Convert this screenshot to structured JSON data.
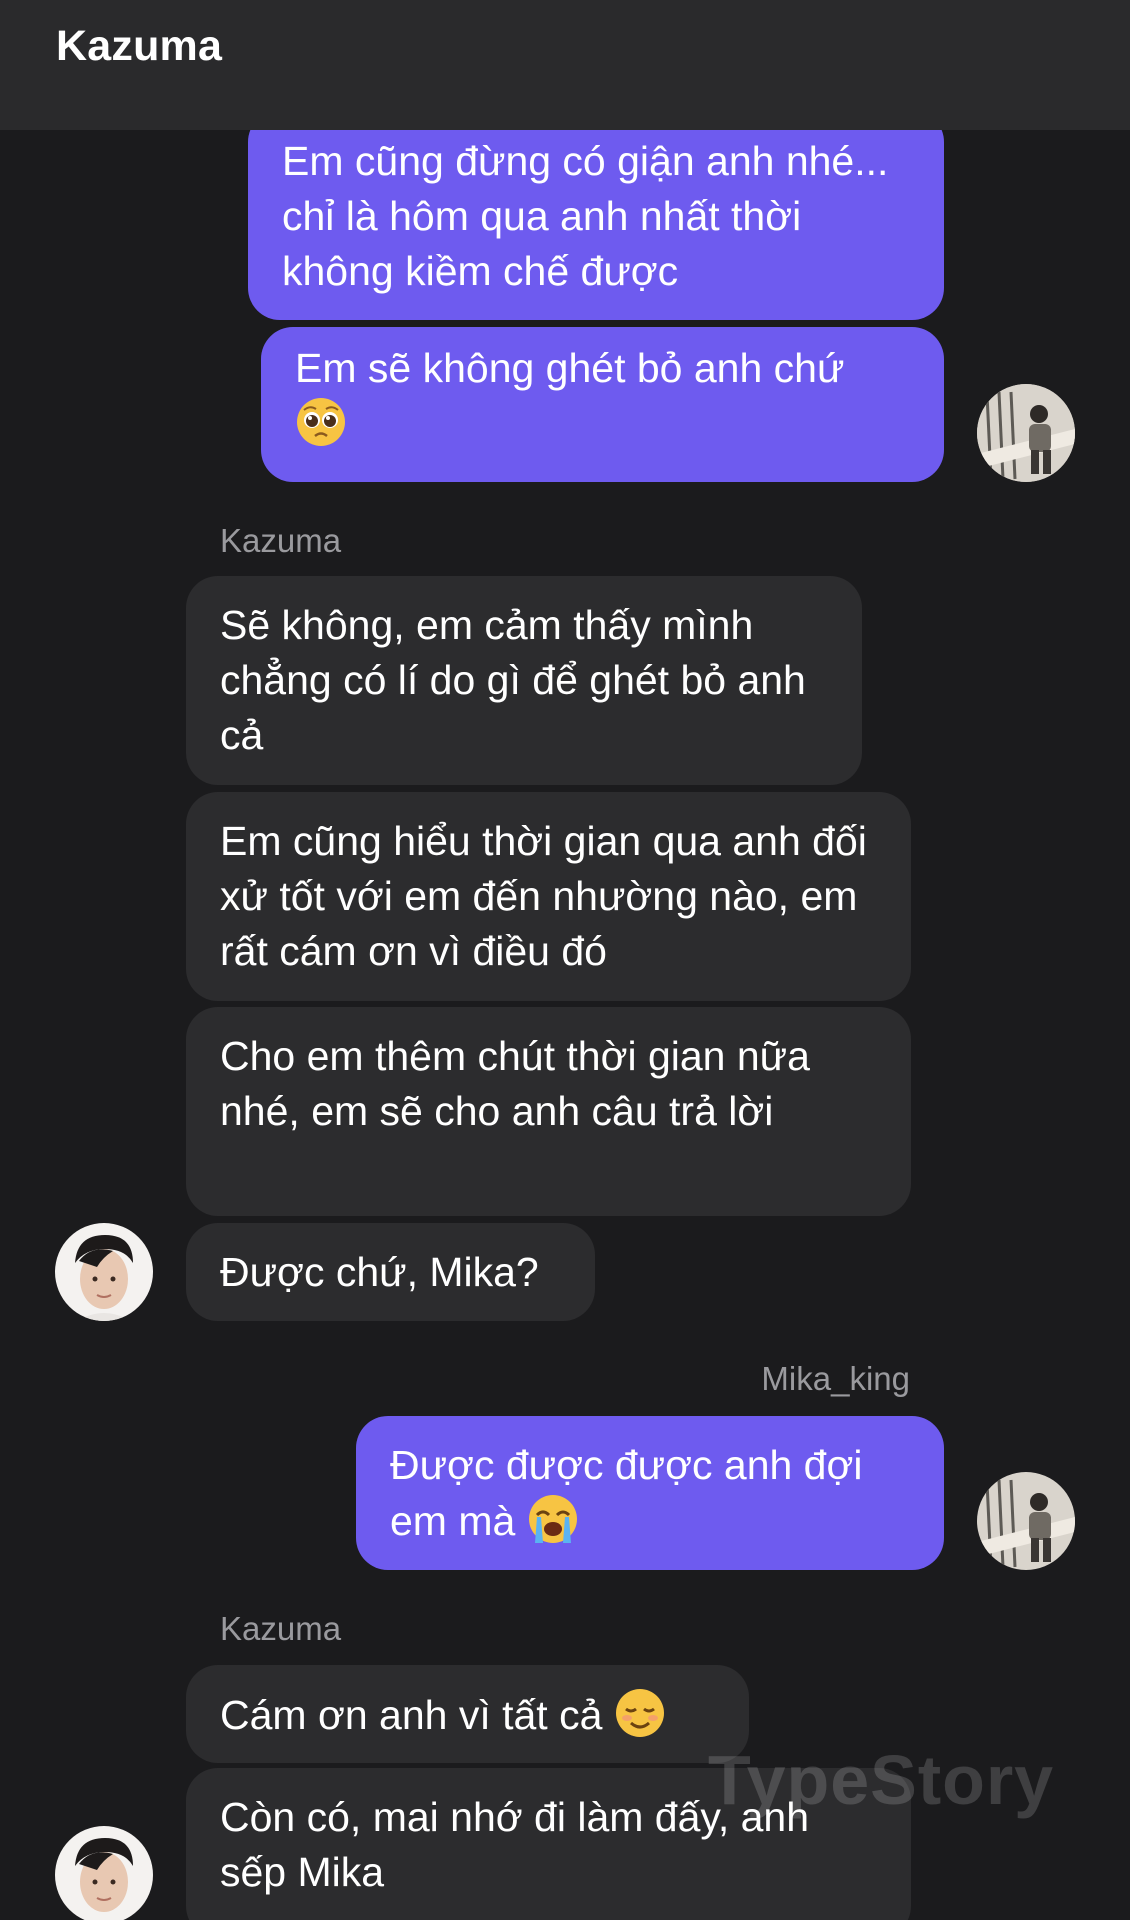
{
  "header": {
    "title": "Kazuma"
  },
  "messages": {
    "m1": "Em cũng đừng có giận anh nhé... chỉ là hôm qua anh nhất thời không kiềm chế được",
    "m2": "Em sẽ không ghét bỏ anh chứ",
    "m3": "Sẽ không, em cảm thấy mình chẳng có lí do gì để ghét bỏ anh cả",
    "m4": "Em cũng hiểu thời gian qua anh đối xử tốt với em đến nhường nào, em rất cám ơn vì điều đó",
    "m5": "Cho em thêm chút thời gian nữa nhé, em sẽ cho anh câu trả lời",
    "m6": "Được chứ, Mika?",
    "m7": "Được được được anh đợi em mà",
    "m8": "Cám ơn anh vì tất cả",
    "m9": "Còn có, mai nhớ đi làm đấy, anh sếp Mika"
  },
  "senders": {
    "kazuma_1": "Kazuma",
    "mika": "Mika_king",
    "kazuma_2": "Kazuma"
  },
  "emoji": {
    "m2": "pleading-face",
    "m7": "loudly-crying-face",
    "m8": "smiling-face"
  },
  "watermark": "TypeStory",
  "colors": {
    "sent_bubble": "#6e5bef",
    "received_bubble": "#2c2c2e",
    "background": "#1b1b1d",
    "header": "#2a2a2c"
  }
}
